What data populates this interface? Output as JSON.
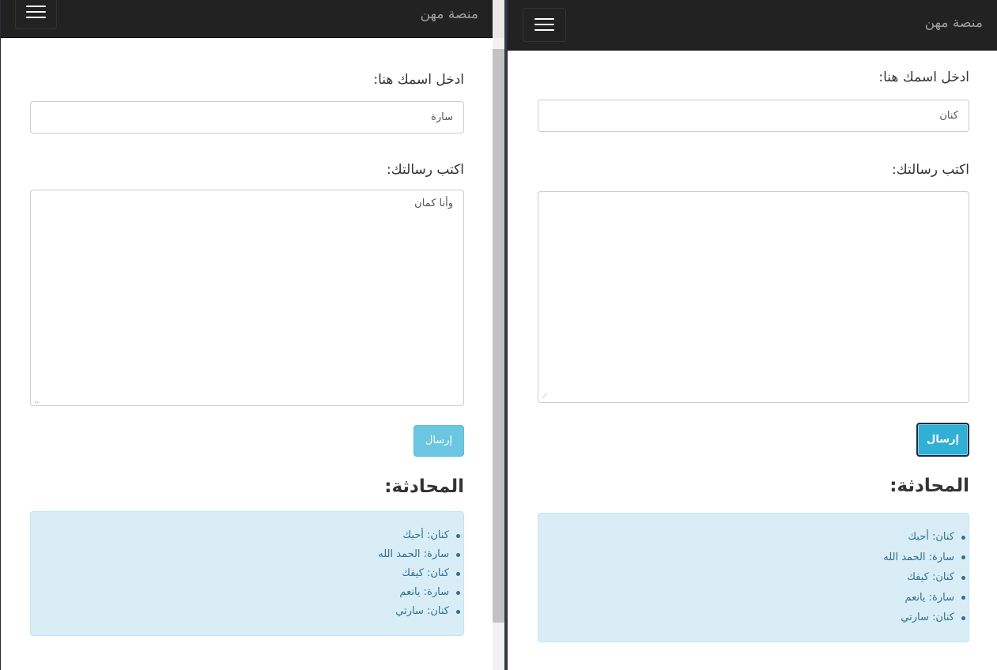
{
  "app": {
    "brand": "منصة مهن"
  },
  "form": {
    "name_label": "ادخل اسمك هنا:",
    "message_label": "اكتب رسالتك:",
    "send_label": "إرسال",
    "chat_title": "المحادثة:"
  },
  "left_window": {
    "name_value": "سارة",
    "message_value": "وأنا كمان",
    "send_button_state": "disabled"
  },
  "right_window": {
    "name_value": "كنان",
    "message_value": "",
    "send_button_state": "focused"
  },
  "chat": {
    "messages": [
      "كنان: أحبك",
      "سارة: الحمد الله",
      "كنان: كيفك",
      "سارة: يانعم",
      "كنان: سارتي"
    ]
  },
  "colors": {
    "navbar": "#222222",
    "brand_text": "#9d9d9d",
    "button": "#5bc0de",
    "chat_bg": "#d9edf7",
    "chat_text": "#31708f"
  },
  "icons": {
    "menu": "hamburger-icon",
    "resize": "resize-grip-icon"
  }
}
